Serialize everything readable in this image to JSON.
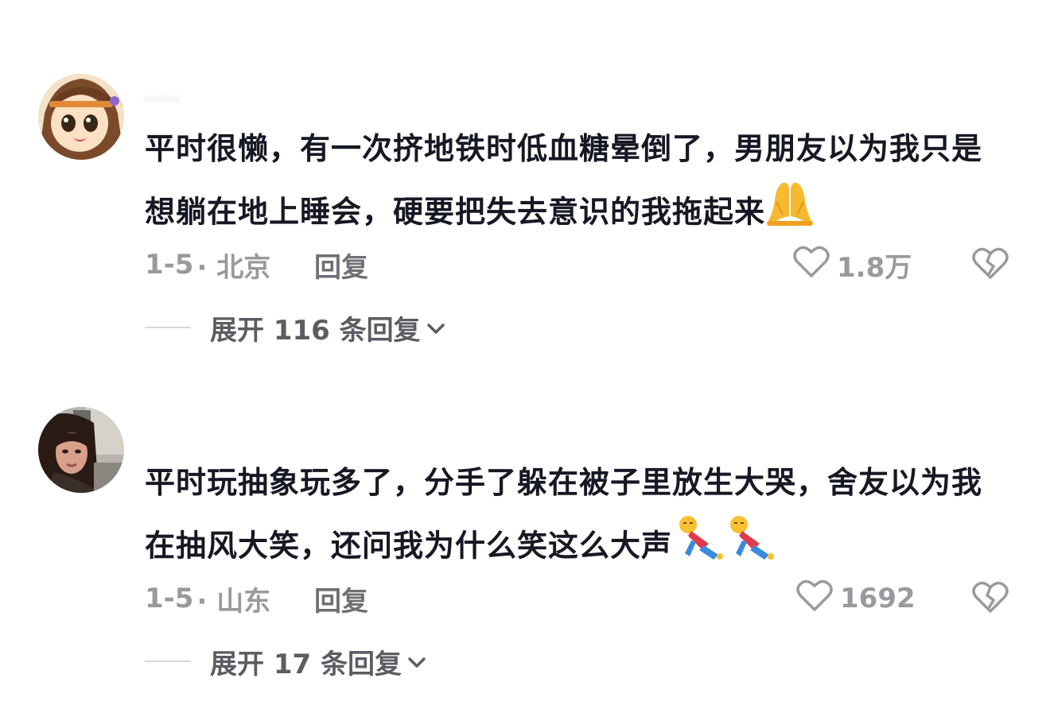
{
  "comments": [
    {
      "username": "ـ.ـ.ـ",
      "text": "平时很懒，有一次挤地铁时低血糖晕倒了，男朋友以为我只是想躺在地上睡会，硬要把失去意识的我拖起来",
      "emoji": "folded-hands",
      "date": "1-5",
      "location": "· 北京",
      "reply_label": "回复",
      "likes": "1.8万",
      "expand_label": "展开 116 条回复"
    },
    {
      "username": "",
      "text": "平时玩抽象玩多了，分手了躲在被子里放生大哭，舍友以为我在抽风大笑，还问我为什么笑这么大声",
      "emoji": "falling-person x2",
      "date": "1-5",
      "location": "· 山东",
      "reply_label": "回复",
      "likes": "1692",
      "expand_label": "展开 17 条回复"
    }
  ],
  "icons": {
    "like": "heart-outline-icon",
    "dislike": "broken-heart-icon",
    "expand": "chevron-down-icon"
  },
  "colors": {
    "text_primary": "#161823",
    "text_meta": "#9a9a9e",
    "text_reply": "#6f6f74"
  }
}
